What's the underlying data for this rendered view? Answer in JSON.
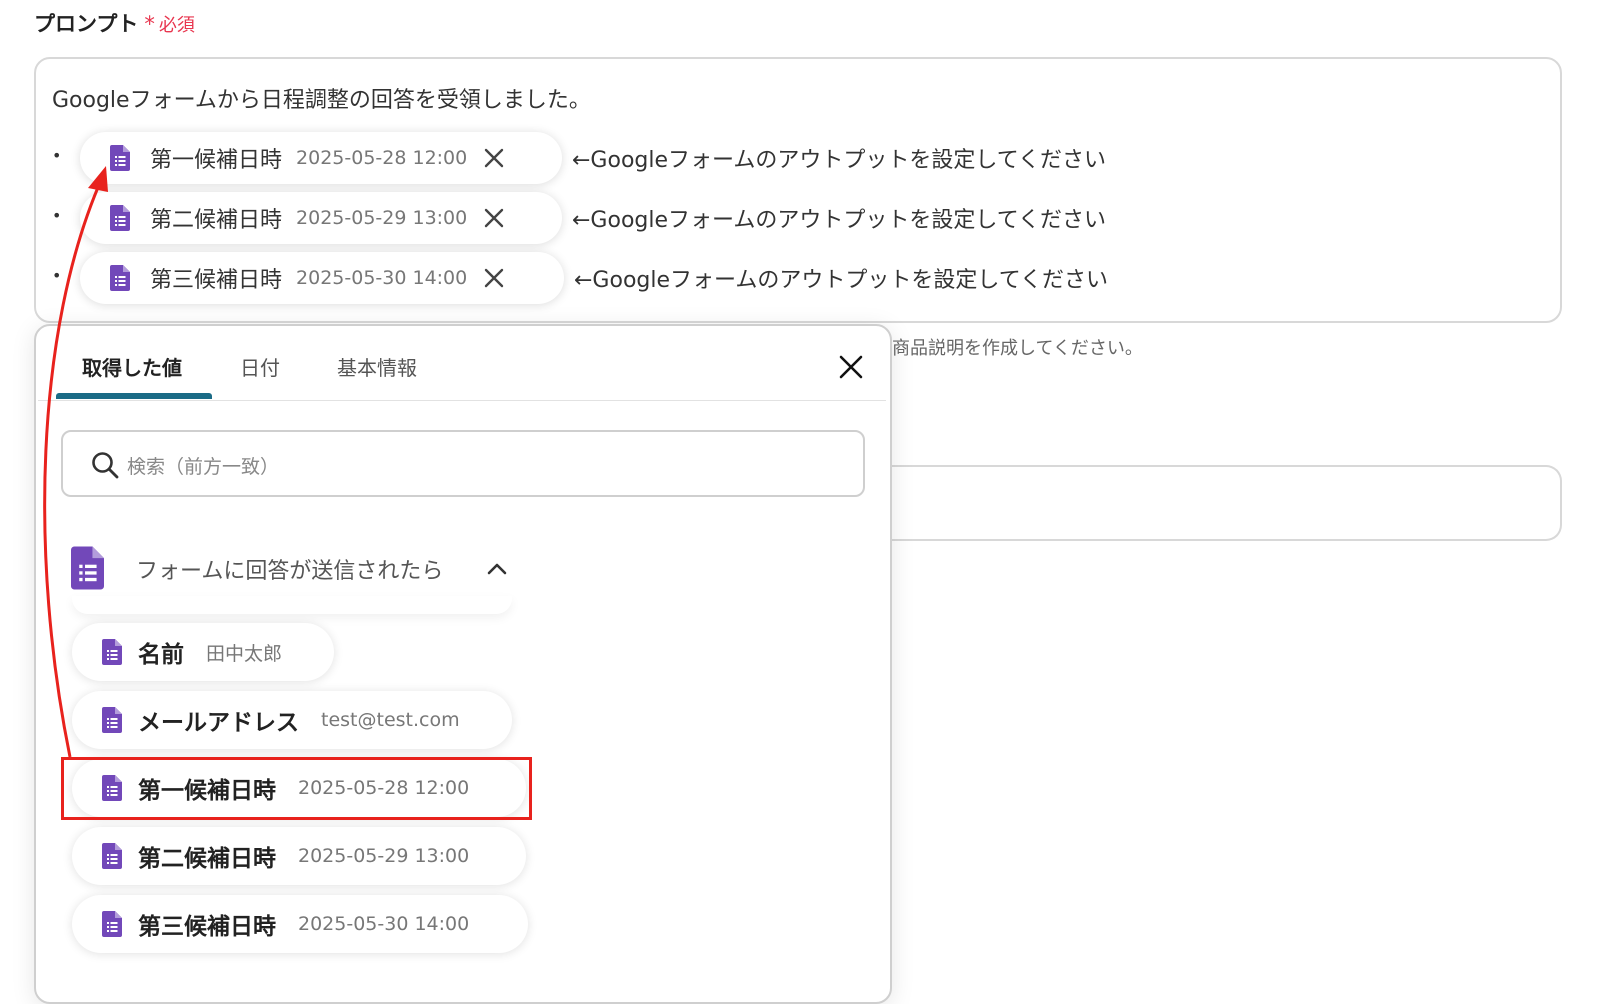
{
  "field": {
    "label": "プロンプト",
    "required_star": "*",
    "required_text": "必須"
  },
  "prompt": {
    "intro": "Googleフォームから日程調整の回答を受領しました。",
    "bullet": "•",
    "lines": [
      {
        "label": "第一候補日時",
        "value": "2025-05-28 12:00",
        "note": "←Googleフォームのアウトプットを設定してください"
      },
      {
        "label": "第二候補日時",
        "value": "2025-05-29 13:00",
        "note": "←Googleフォームのアウトプットを設定してください"
      },
      {
        "label": "第三候補日時",
        "value": "2025-05-30 14:00",
        "note": "←Googleフォームのアウトプットを設定してください"
      }
    ]
  },
  "helper_text": "商品説明を作成してください。",
  "popup": {
    "tabs": [
      {
        "label": "取得した値",
        "active": true
      },
      {
        "label": "日付",
        "active": false
      },
      {
        "label": "基本情報",
        "active": false
      }
    ],
    "search_placeholder": "検索（前方一致）",
    "group": {
      "title": "フォームに回答が送信されたら",
      "icon": "google-forms-icon",
      "expanded": true
    },
    "items": [
      {
        "label": "名前",
        "value": "田中太郎"
      },
      {
        "label": "メールアドレス",
        "value": "test@test.com"
      },
      {
        "label": "第一候補日時",
        "value": "2025-05-28 12:00",
        "highlighted": true
      },
      {
        "label": "第二候補日時",
        "value": "2025-05-29 13:00"
      },
      {
        "label": "第三候補日時",
        "value": "2025-05-30 14:00"
      }
    ]
  },
  "colors": {
    "forms_purple": "#7248b9",
    "required_red": "#e8364f",
    "tab_underline": "#1a6b86",
    "annotation_red": "#e8221d"
  }
}
